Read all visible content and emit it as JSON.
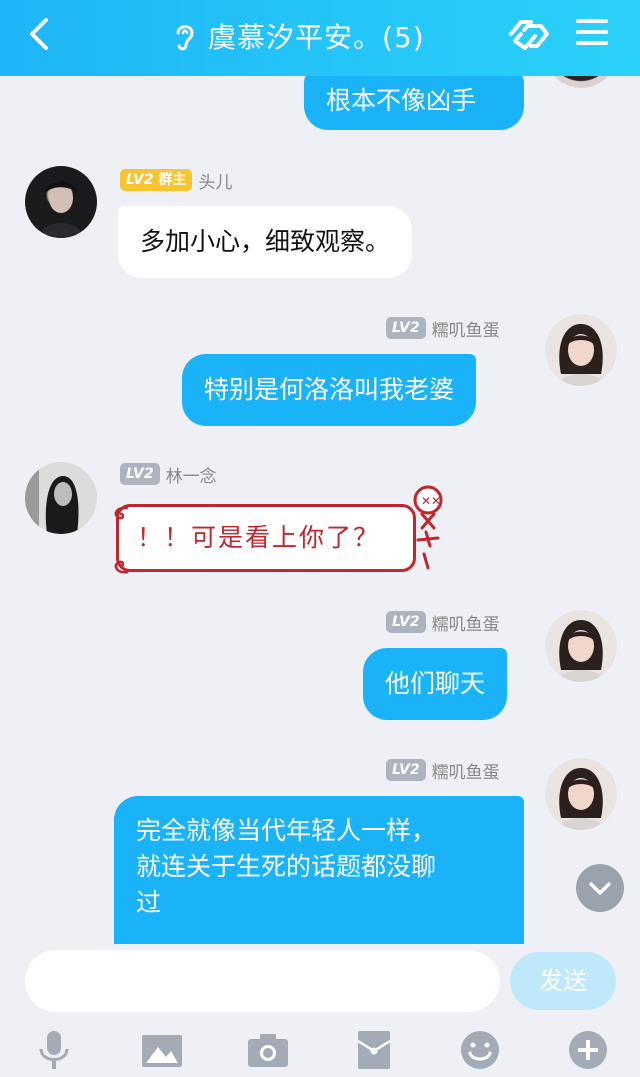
{
  "header": {
    "title": "虞慕汐平安。(5)",
    "icons": [
      "back-icon",
      "ear-icon",
      "share-link-icon",
      "menu-icon"
    ]
  },
  "colors": {
    "header": "#1fb5f7",
    "bubble_out": "#1bb3f7",
    "bubble_in": "#ffffff",
    "level_badge": "#aeb4bf",
    "owner_badge": "#f6c531",
    "special_bubble_border": "#c0262b"
  },
  "messages": [
    {
      "side": "out",
      "text": "根本不像凶手"
    },
    {
      "side": "in",
      "level": "LV2",
      "role": "群主",
      "name": "头儿",
      "text": "多加小心，细致观察。"
    },
    {
      "side": "out",
      "level": "LV2",
      "name": "糯叽鱼蛋",
      "text": "特别是何洛洛叫我老婆"
    },
    {
      "side": "in",
      "level": "LV2",
      "name": "林一念",
      "text": "！！可是看上你了？"
    },
    {
      "side": "out",
      "level": "LV2",
      "name": "糯叽鱼蛋",
      "text": "他们聊天"
    },
    {
      "side": "out",
      "level": "LV2",
      "name": "糯叽鱼蛋",
      "lines": [
        "完全就像当代年轻人一样，",
        "就连关于生死的话题都没聊",
        "过"
      ]
    }
  ],
  "input": {
    "value": "",
    "placeholder": ""
  },
  "send_label": "发送",
  "toolbar": [
    "microphone-icon",
    "image-icon",
    "camera-icon",
    "red-packet-icon",
    "emoji-icon",
    "plus-icon"
  ]
}
